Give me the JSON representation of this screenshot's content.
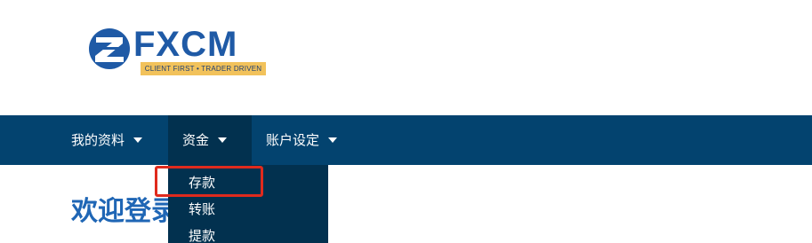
{
  "brand": {
    "name": "FXCM",
    "tagline": "CLIENT FIRST • TRADER DRIVEN",
    "primary_color": "#1f5aa6",
    "tagline_bg": "#f2c25b"
  },
  "nav": {
    "bg_color": "#03436f",
    "items": [
      {
        "label": "我的资料",
        "icon": "caret-down-icon"
      },
      {
        "label": "资金",
        "icon": "caret-down-icon",
        "active": true
      },
      {
        "label": "账户设定",
        "icon": "caret-down-icon"
      }
    ]
  },
  "dropdown": {
    "items": [
      {
        "label": "存款",
        "highlighted": true
      },
      {
        "label": "转账"
      },
      {
        "label": "提款"
      }
    ],
    "highlight_color": "#e02a1d"
  },
  "main": {
    "welcome": "欢迎登录"
  }
}
